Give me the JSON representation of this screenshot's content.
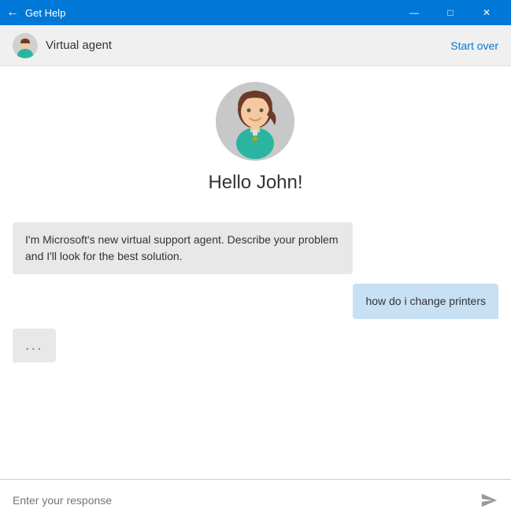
{
  "titleBar": {
    "title": "Get Help",
    "backArrow": "←",
    "minimizeBtn": "—",
    "maximizeBtn": "□",
    "closeBtn": "✕"
  },
  "subHeader": {
    "agentName": "Virtual agent",
    "startOverLabel": "Start over"
  },
  "agentIntro": {
    "greeting": "Hello John!"
  },
  "messages": [
    {
      "type": "agent",
      "text": "I'm Microsoft's new virtual support agent. Describe your problem and I'll look for the best solution."
    },
    {
      "type": "user",
      "text": "how do i change printers"
    },
    {
      "type": "typing",
      "text": "..."
    }
  ],
  "inputArea": {
    "placeholder": "Enter your response",
    "sendIcon": "send"
  }
}
